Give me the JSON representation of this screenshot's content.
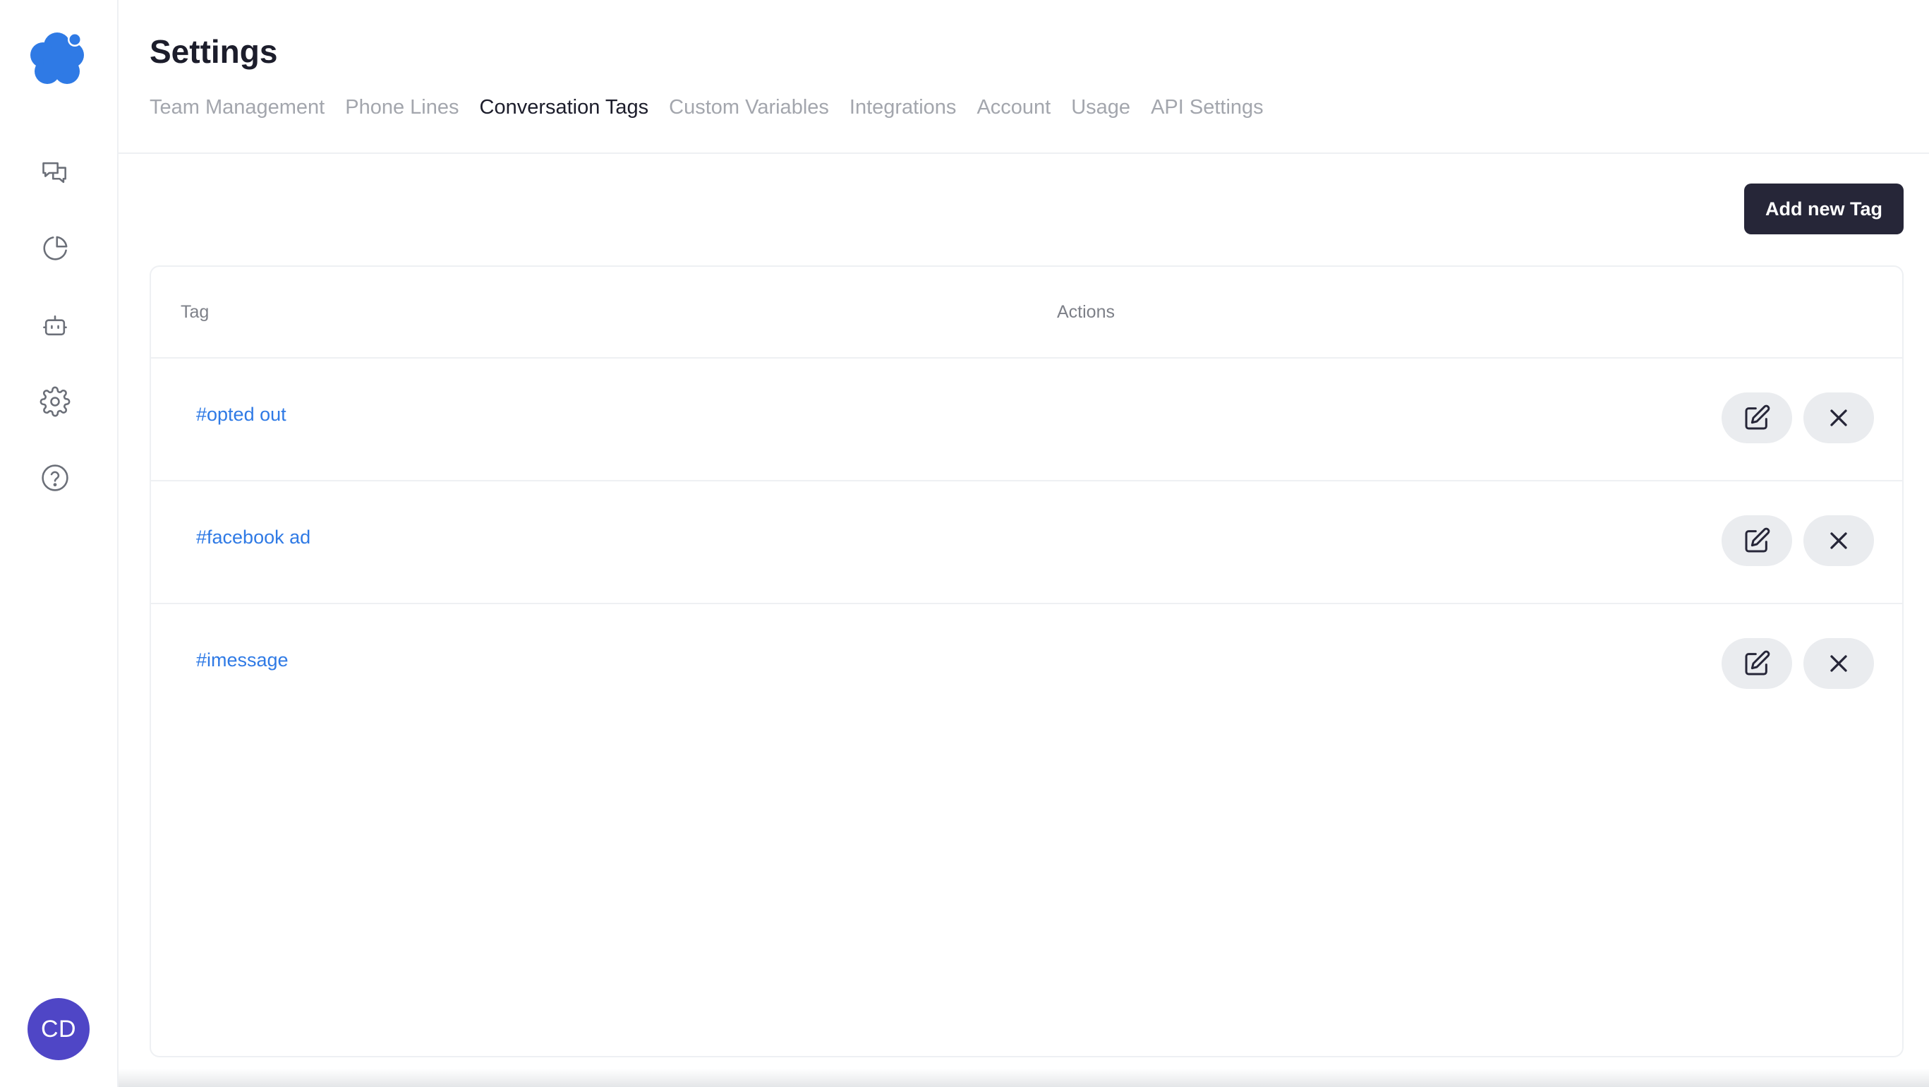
{
  "app": {
    "accent_color": "#2f7ae5",
    "logo_icon": "flower-logo-icon"
  },
  "sidebar": {
    "items": [
      {
        "name": "conversations",
        "icon": "chat-bubbles-icon"
      },
      {
        "name": "analytics",
        "icon": "pie-chart-icon"
      },
      {
        "name": "bots",
        "icon": "robot-icon"
      },
      {
        "name": "settings",
        "icon": "gear-icon"
      },
      {
        "name": "help",
        "icon": "help-circle-icon"
      }
    ],
    "avatar": {
      "initials": "CD",
      "color": "#4f46c6"
    }
  },
  "header": {
    "title": "Settings",
    "tabs": [
      {
        "label": "Team Management",
        "active": false
      },
      {
        "label": "Phone Lines",
        "active": false
      },
      {
        "label": "Conversation Tags",
        "active": true
      },
      {
        "label": "Custom Variables",
        "active": false
      },
      {
        "label": "Integrations",
        "active": false
      },
      {
        "label": "Account",
        "active": false
      },
      {
        "label": "Usage",
        "active": false
      },
      {
        "label": "API Settings",
        "active": false
      }
    ]
  },
  "toolbar": {
    "add_label": "Add new Tag"
  },
  "table": {
    "columns": {
      "tag": "Tag",
      "actions": "Actions"
    },
    "rows": [
      {
        "tag": "#opted out"
      },
      {
        "tag": "#facebook ad"
      },
      {
        "tag": "#imessage"
      }
    ],
    "row_action_icons": [
      "edit-icon",
      "close-icon"
    ]
  }
}
